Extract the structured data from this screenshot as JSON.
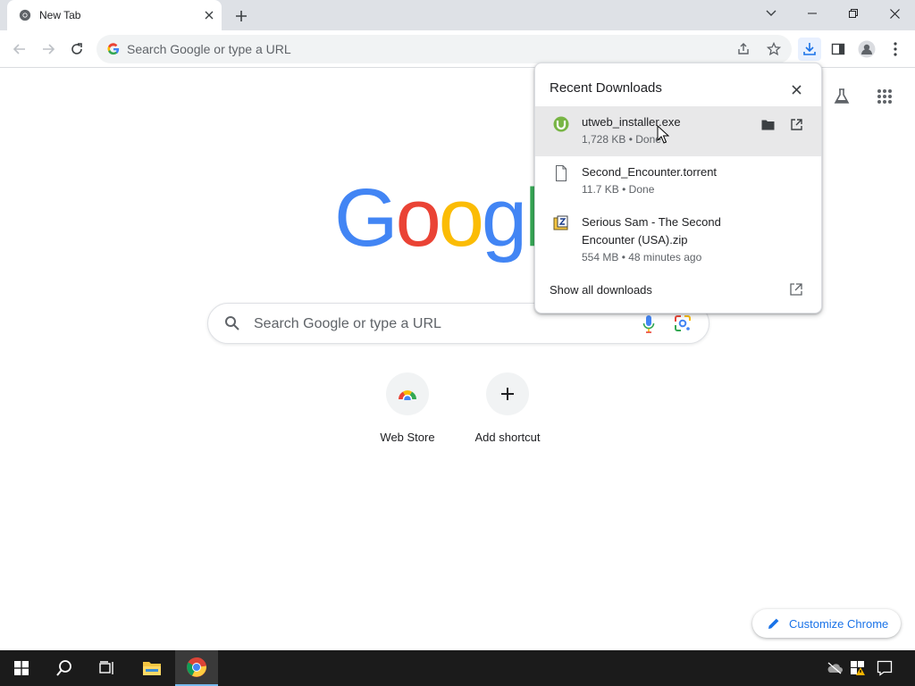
{
  "browser": {
    "tab": {
      "title": "New Tab"
    },
    "omnibox": {
      "placeholder": "Search Google or type a URL"
    }
  },
  "ntp": {
    "logo_letters": [
      {
        "ch": "G",
        "color": "#4285f4"
      },
      {
        "ch": "o",
        "color": "#ea4335"
      },
      {
        "ch": "o",
        "color": "#fbbc05"
      },
      {
        "ch": "g",
        "color": "#4285f4"
      },
      {
        "ch": "l",
        "color": "#34a853"
      }
    ],
    "search": {
      "placeholder": "Search Google or type a URL"
    },
    "shortcuts": [
      {
        "label": "Web Store"
      },
      {
        "label": "Add shortcut"
      }
    ],
    "customize_label": "Customize Chrome"
  },
  "downloads": {
    "title": "Recent Downloads",
    "items": [
      {
        "name": "utweb_installer.exe",
        "meta": "1,728 KB • Done"
      },
      {
        "name": "Second_Encounter.torrent",
        "meta": "11.7 KB • Done"
      },
      {
        "name": "Serious Sam - The Second Encounter (USA).zip",
        "meta": "554 MB • 48 minutes ago"
      }
    ],
    "show_all_label": "Show all downloads"
  },
  "colors": {
    "accent": "#1a73e8",
    "tabstrip": "#dee1e6",
    "taskbar": "#1b1b1b"
  }
}
